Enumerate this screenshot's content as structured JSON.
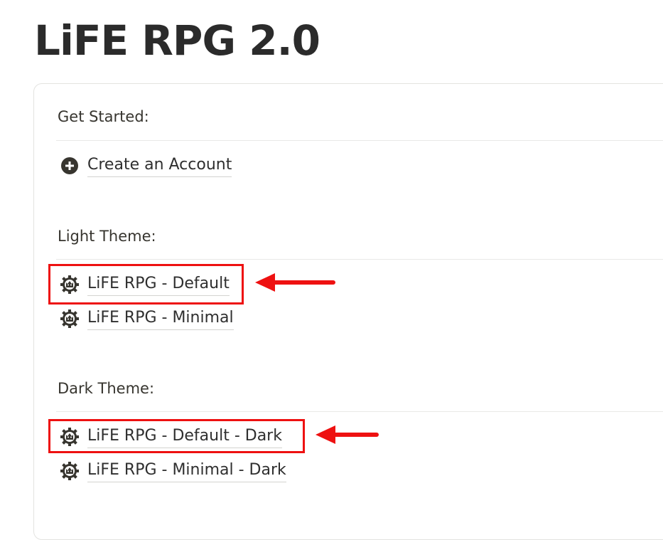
{
  "page": {
    "title": "LiFE RPG 2.0"
  },
  "sections": {
    "get_started": {
      "heading": "Get Started:",
      "items": [
        {
          "label": "Create an Account",
          "icon": "plus-circle-icon"
        }
      ]
    },
    "light_theme": {
      "heading": "Light Theme:",
      "items": [
        {
          "label": "LiFE RPG - Default",
          "icon": "gear-cat-icon",
          "highlighted": true
        },
        {
          "label": "LiFE RPG - Minimal",
          "icon": "gear-cat-icon",
          "highlighted": false
        }
      ]
    },
    "dark_theme": {
      "heading": "Dark Theme:",
      "items": [
        {
          "label": "LiFE RPG - Default - Dark",
          "icon": "gear-cat-icon",
          "highlighted": true
        },
        {
          "label": "LiFE RPG - Minimal - Dark",
          "icon": "gear-cat-icon",
          "highlighted": false
        }
      ]
    }
  },
  "annotations": {
    "highlight_color": "#ee1111"
  }
}
